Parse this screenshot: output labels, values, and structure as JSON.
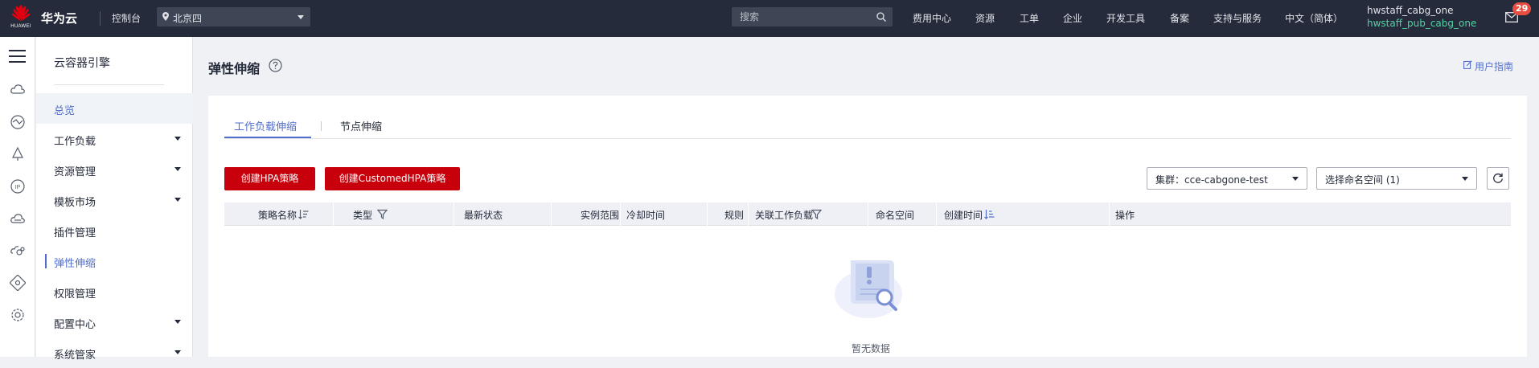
{
  "topbar": {
    "logo_text": "HUAWEI",
    "brand": "华为云",
    "console": "控制台",
    "region": "北京四",
    "search_placeholder": "搜索",
    "nav": [
      "费用中心",
      "资源",
      "工单",
      "企业",
      "开发工具",
      "备案",
      "支持与服务",
      "中文（简体）"
    ],
    "user_name": "hwstaff_cabg_one",
    "user_sub": "hwstaff_pub_cabg_one",
    "message_count": "29"
  },
  "rail": {
    "icons": [
      "cloud-icon",
      "network-icon",
      "tree-icon",
      "ip-icon",
      "cloud-service-icon",
      "cloud-link-icon",
      "target-icon",
      "settings-cog-icon"
    ]
  },
  "sidebar": {
    "title": "云容器引擎",
    "items": [
      {
        "label": "总览",
        "state": "active",
        "expandable": false
      },
      {
        "label": "工作负载",
        "state": "",
        "expandable": true
      },
      {
        "label": "资源管理",
        "state": "",
        "expandable": true
      },
      {
        "label": "模板市场",
        "state": "",
        "expandable": true
      },
      {
        "label": "插件管理",
        "state": "",
        "expandable": false
      },
      {
        "label": "弹性伸缩",
        "state": "current",
        "expandable": false
      },
      {
        "label": "权限管理",
        "state": "",
        "expandable": false
      },
      {
        "label": "配置中心",
        "state": "",
        "expandable": true
      },
      {
        "label": "系统管家",
        "state": "",
        "expandable": true
      }
    ]
  },
  "main": {
    "page_title": "弹性伸缩",
    "user_guide": "用户指南",
    "tabs": [
      "工作负载伸缩",
      "节点伸缩"
    ],
    "buttons": {
      "create_hpa": "创建HPA策略",
      "create_customed_hpa": "创建CustomedHPA策略"
    },
    "cluster_select": "集群：cce-cabgone-test",
    "namespace_select": "选择命名空间 (1)",
    "table": {
      "columns": [
        "策略名称",
        "类型",
        "最新状态",
        "实例范围",
        "冷却时间",
        "规则",
        "关联工作负载",
        "命名空间",
        "创建时间",
        "操作"
      ]
    },
    "empty_text": "暂无数据"
  },
  "colors": {
    "topbar_bg": "#252b3a",
    "accent": "#526ecc",
    "primary_button": "#c7000b",
    "badge": "#e84e40",
    "user_sub": "#50d4a4"
  }
}
